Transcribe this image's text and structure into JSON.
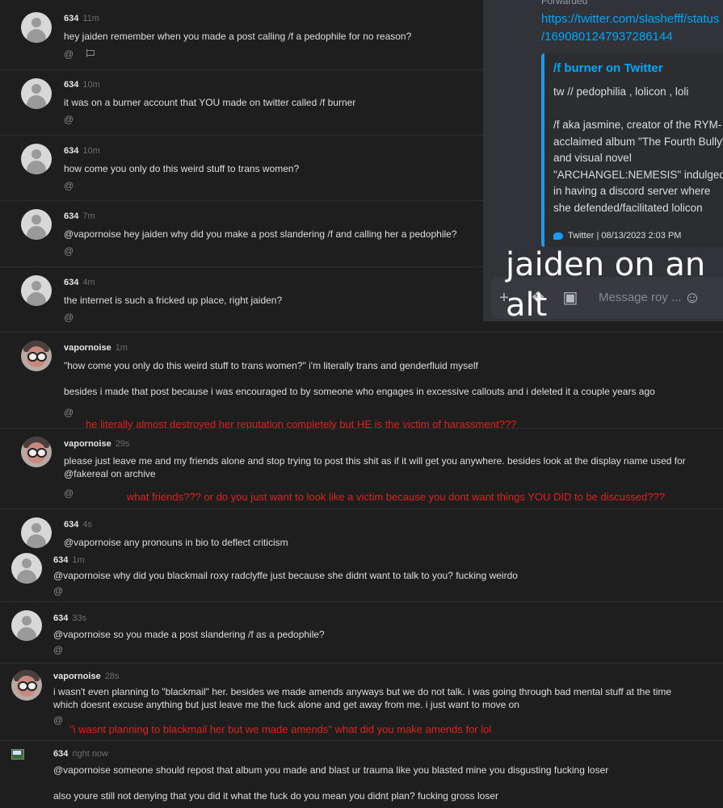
{
  "messages": [
    {
      "user": "634",
      "time": "11m",
      "text": "hey jaiden remember when you made a post calling /f a pedophile for no reason?"
    },
    {
      "user": "634",
      "time": "10m",
      "text": "it was on a burner account that YOU made on twitter called /f burner"
    },
    {
      "user": "634",
      "time": "10m",
      "text": "how come you only do this weird stuff to trans women?"
    },
    {
      "user": "634",
      "time": "7m",
      "text": "@vapornoise hey jaiden why did you make a post slandering /f and calling her a pedophile?"
    },
    {
      "user": "634",
      "time": "4m",
      "text": "the internet is such a fricked up place, right jaiden?"
    },
    {
      "user": "vapornoise",
      "time": "1m",
      "text": "\"how come you only do this weird stuff to trans women?\" i'm literally trans and genderfluid myself\n\nbesides i made that post because i was encouraged to by someone who engages in excessive callouts and i deleted it a couple years ago"
    },
    {
      "user": "vapornoise",
      "time": "29s",
      "text": "please just leave me and my friends alone and stop trying to post this shit as if it will get you anywhere. besides look at the display name used for @fakereal on archive"
    },
    {
      "user": "634",
      "time": "4s",
      "text": "@vapornoise any pronouns in bio to deflect criticism"
    },
    {
      "user": "634",
      "time": "1m",
      "text": "@vapornoise why did you blackmail roxy radclyffe just because she didnt want to talk to you? fucking weirdo"
    },
    {
      "user": "634",
      "time": "33s",
      "text": "@vapornoise so you made a post slandering /f as a pedophile?"
    },
    {
      "user": "vapornoise",
      "time": "28s",
      "text": "i wasn't even planning to \"blackmail\" her. besides we made amends anyways but we do not talk. i was going through bad mental stuff at the time\nwhich doesnt excuse anything but just leave me the fuck alone and get away from me. i just want to move on"
    },
    {
      "user": "634",
      "time": "right now",
      "text": "@vapornoise someone should repost that album you made and blast ur trauma like you blasted mine you disgusting fucking loser\n\nalso youre still not denying that you did it what the fuck do you mean you didnt plan? fucking gross loser"
    }
  ],
  "actions": {
    "mention": "@"
  },
  "annotations": [
    "he literally almost destroyed her reputation completely but HE is the victim of harassment???",
    "what friends??? or do you just want to look like a victim because you dont want things YOU DID to be discussed???",
    "\"i wasnt planning to blackmail her but we made amends\" what did you make amends for lol"
  ],
  "discord": {
    "forwarded_label": "Forwarded",
    "link": "https://twitter.com/slashefff/status\n/1690801247937286144",
    "embed_title": "/f burner on Twitter",
    "embed_desc": "tw // pedophilia , lolicon , loli\n\n/f aka jasmine, creator of the RYM-acclaimed album \"The Fourth Bully\" and visual novel \"ARCHANGEL:NEMESIS\" indulged in having a discord server where she defended/facilitated lolicon",
    "embed_footer": "Twitter | 08/13/2023 2:03 PM",
    "placeholder": "Message roy ...",
    "icons": [
      "plus-icon",
      "gift-icon",
      "sticker-icon",
      "emoji-icon"
    ]
  },
  "overlay_caption": "jaiden on an\nalt"
}
